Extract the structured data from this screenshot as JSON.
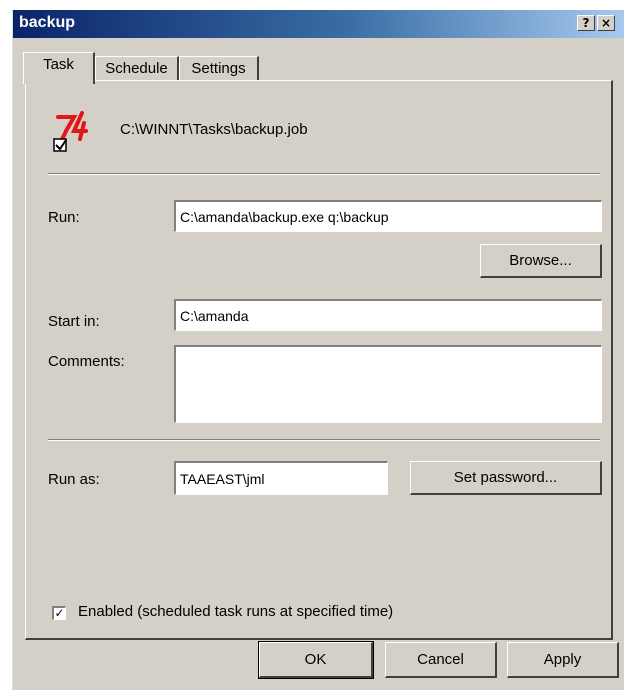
{
  "window": {
    "title": "backup",
    "help_glyph": "?",
    "close_glyph": "×"
  },
  "tabs": [
    {
      "label": "Task",
      "active": true
    },
    {
      "label": "Schedule",
      "active": false
    },
    {
      "label": "Settings",
      "active": false
    }
  ],
  "task": {
    "icon": "task-scheduler-icon",
    "path": "C:\\WINNT\\Tasks\\backup.job"
  },
  "form": {
    "run_label": "Run:",
    "run_value": "C:\\amanda\\backup.exe q:\\backup",
    "browse_label": "Browse...",
    "start_in_label": "Start in:",
    "start_in_value": "C:\\amanda",
    "comments_label": "Comments:",
    "comments_value": "",
    "run_as_label": "Run as:",
    "run_as_value": "TAAEAST\\jml",
    "set_password_label": "Set password...",
    "enabled_checked": true,
    "enabled_mark": "✓",
    "enabled_label": "Enabled (scheduled task runs at specified time)"
  },
  "footer": {
    "ok_label": "OK",
    "cancel_label": "Cancel",
    "apply_label": "Apply"
  },
  "colors": {
    "titlebar_start": "#0a246a",
    "titlebar_end": "#a6caf0",
    "face": "#d4d0c8",
    "icon_red": "#e0161b"
  }
}
